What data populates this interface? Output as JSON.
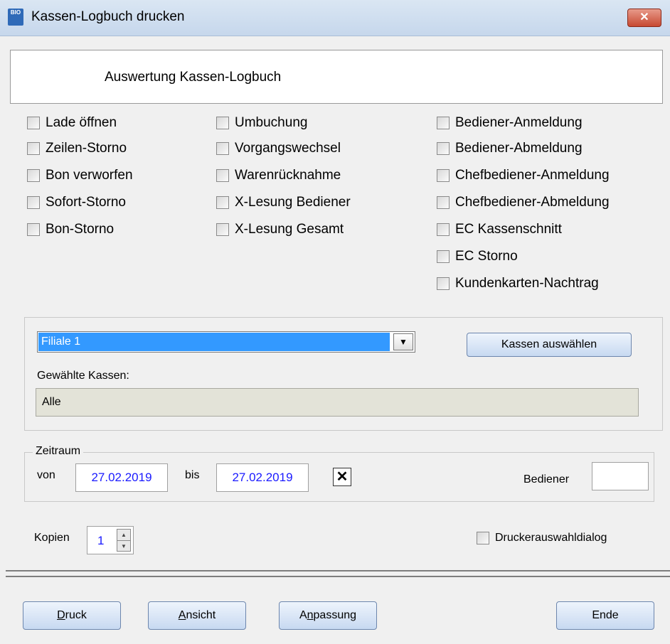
{
  "window": {
    "title": "Kassen-Logbuch drucken",
    "app_icon_text": "BIO",
    "close_glyph": "✕"
  },
  "header": {
    "title": "Auswertung Kassen-Logbuch"
  },
  "checkboxes": {
    "col1": [
      "Lade öffnen",
      "Zeilen-Storno",
      "Bon verworfen",
      "Sofort-Storno",
      "Bon-Storno"
    ],
    "col2": [
      "Umbuchung",
      "Vorgangswechsel",
      "Warenrücknahme",
      "X-Lesung Bediener",
      "X-Lesung Gesamt"
    ],
    "col3": [
      "Bediener-Anmeldung",
      "Bediener-Abmeldung",
      "Chefbediener-Anmeldung",
      "Chefbediener-Abmeldung",
      "EC Kassenschnitt",
      "EC Storno",
      "Kundenkarten-Nachtrag"
    ]
  },
  "branch": {
    "selected": "Filiale 1",
    "select_registers_label": "Kassen auswählen",
    "chosen_label": "Gewählte Kassen:",
    "chosen_value": "Alle"
  },
  "period": {
    "legend": "Zeitraum",
    "from_label": "von",
    "from_value": "27.02.2019",
    "to_label": "bis",
    "to_value": "27.02.2019",
    "clear_glyph": "✕",
    "operator_label": "Bediener",
    "operator_value": ""
  },
  "copies": {
    "label": "Kopien",
    "value": "1"
  },
  "printer_dialog": {
    "label": "Druckerauswahldialog"
  },
  "buttons": {
    "print": {
      "mnemonic": "D",
      "rest": "ruck"
    },
    "view": {
      "mnemonic": "A",
      "rest": "nsicht"
    },
    "adjust": {
      "pre": "A",
      "mnemonic": "n",
      "rest": "passung"
    },
    "end": "Ende"
  }
}
